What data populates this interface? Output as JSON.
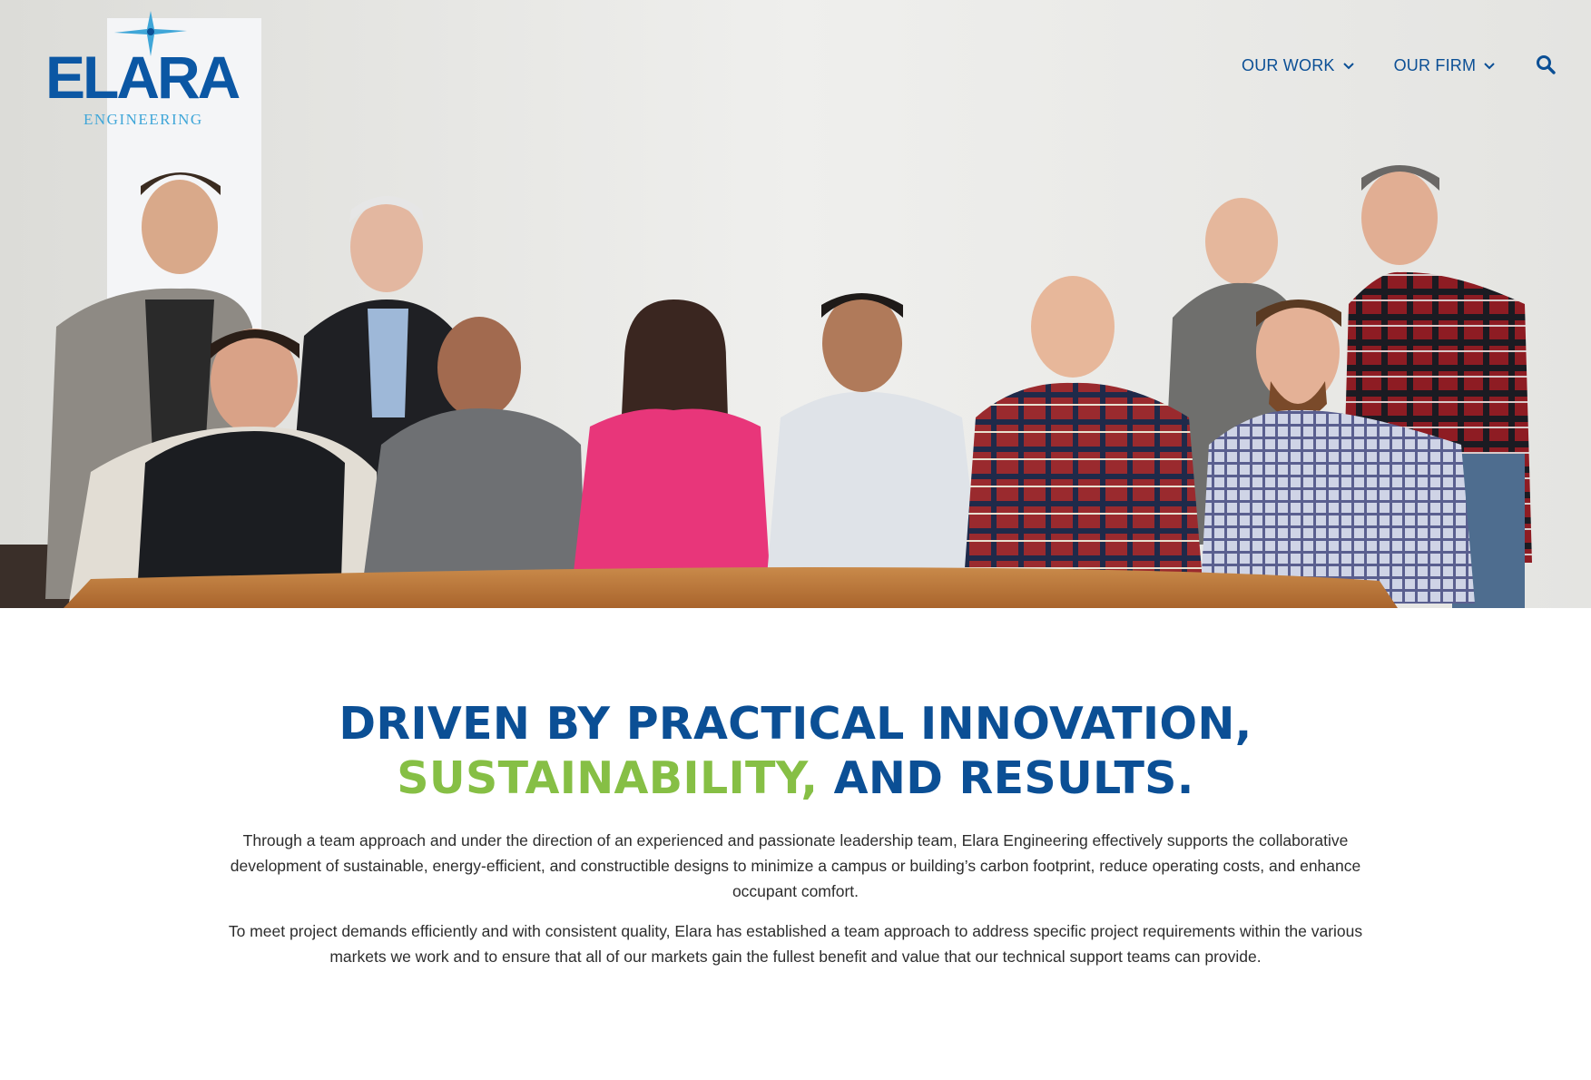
{
  "brand": {
    "name": "ELARA",
    "subtitle": "ENGINEERING",
    "colors": {
      "primary": "#0b4f95",
      "accent": "#86bf45",
      "logo_light": "#3fa6d8"
    }
  },
  "nav": {
    "items": [
      {
        "label": "OUR WORK",
        "icon": "chevron-down-icon"
      },
      {
        "label": "OUR FIRM",
        "icon": "chevron-down-icon"
      }
    ],
    "search_icon": "search-icon"
  },
  "hero": {
    "alt": "Elara Engineering team group photo"
  },
  "headline": {
    "line1": "DRIVEN BY PRACTICAL INNOVATION,",
    "line2_highlight": "SUSTAINABILITY,",
    "line2_rest": " AND RESULTS."
  },
  "body": {
    "paragraph1": "Through a team approach and under the direction of an experienced and passionate leadership team, Elara Engineering effectively supports the collaborative development of sustainable, energy-efficient, and constructible designs to minimize a campus or building’s carbon footprint, reduce operating costs, and enhance occupant comfort.",
    "paragraph2": "To meet project demands efficiently and with consistent quality, Elara has established a team approach to address specific project requirements within the various markets we work and to ensure that all of our markets gain the fullest benefit and value that our technical support teams can provide."
  }
}
